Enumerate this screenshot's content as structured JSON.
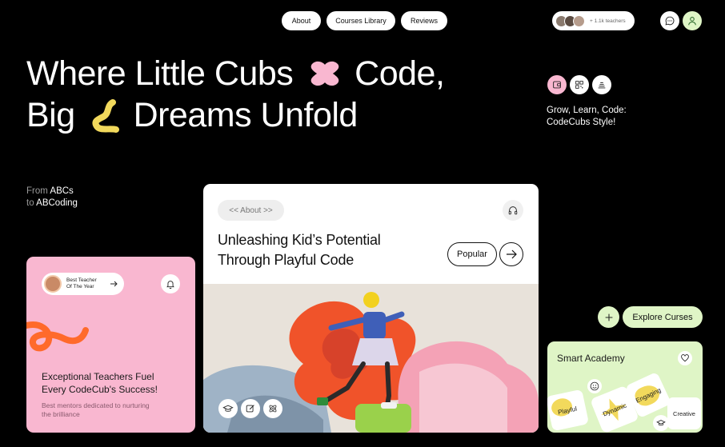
{
  "nav": {
    "about": "About",
    "courses": "Courses Library",
    "reviews": "Reviews",
    "teachers_count": "+ 1.1k teachers"
  },
  "hero": {
    "line1_a": "Where Little Cubs",
    "line1_b": "Code,",
    "line2_a": "Big",
    "line2_b": "Dreams Unfold"
  },
  "tagline": {
    "line1": "Grow, Learn, Code:",
    "line2": "CodeCubs Style!"
  },
  "from_text": {
    "prefix1": "From",
    "em1": "ABCs",
    "prefix2": "to",
    "em2": "ABCoding"
  },
  "pink_card": {
    "badge_line1": "Best Teacher",
    "badge_line2": "Of The Year",
    "heading_line1": "Exceptional Teachers Fuel",
    "heading_line2": "Every CodeCub's Success!",
    "sub_line1": "Best mentors dedicated to nurturing",
    "sub_line2": "the brilliance"
  },
  "center_card": {
    "about_chip": "<< About >>",
    "heading_line1": "Unleashing Kid’s Potential",
    "heading_line2": "Through Playful Code",
    "popular": "Popular"
  },
  "explore": {
    "label": "Explore Curses"
  },
  "green_card": {
    "title": "Smart Academy",
    "tiles": [
      "Playful",
      "Dynamic",
      "Engaging",
      "Creative"
    ]
  },
  "colors": {
    "pink": "#f9b7d0",
    "lime": "#dff5c6",
    "yellow": "#f2d95c",
    "orange": "#ff6a2b"
  }
}
